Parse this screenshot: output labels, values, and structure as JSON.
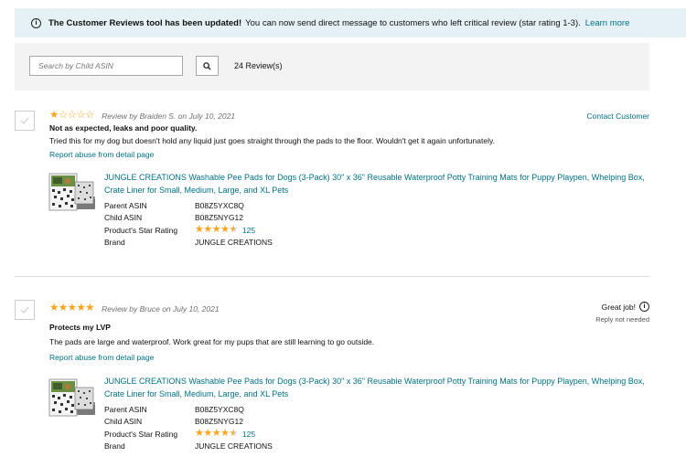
{
  "banner": {
    "bold_text": "The Customer Reviews tool has been updated!",
    "text": "You can now send direct message to customers who left critical review (star rating 1-3).",
    "link": "Learn more"
  },
  "search": {
    "placeholder": "Search by Child ASIN",
    "review_count": "24 Review(s)"
  },
  "icons": {
    "info": "info-icon",
    "search": "search-icon",
    "check": "checkmark-icon",
    "star": "star-icon"
  },
  "colors": {
    "link": "#007185",
    "star": "#ffa41c",
    "banner_bg": "#e5f1f4",
    "search_bg": "#f3f3f3"
  },
  "product_labels": {
    "parent_asin": "Parent ASIN",
    "child_asin": "Child ASIN",
    "star_rating": "Product's Star Rating",
    "brand": "Brand"
  },
  "reviews": [
    {
      "rating": 1,
      "byline": "Review by Braiden S. on July 10, 2021",
      "action": "Contact Customer",
      "title": "Not as expected, leaks and poor quality.",
      "body": "Tried this for my dog but doesn't hold any liquid just goes straight through the pads to the floor. Wouldn't get it again unfortunately.",
      "report": "Report abuse from detail page",
      "product": {
        "title": "JUNGLE CREATIONS Washable Pee Pads for Dogs (3-Pack) 30\" x 36\" Reusable Waterproof Potty Training Mats for Puppy Playpen, Whelping Box, Crate Liner for Small, Medium, Large, and XL Pets",
        "parent_asin": "B08Z5YXC8Q",
        "child_asin": "B08Z5NYG12",
        "star_rating": 4.5,
        "rating_count": "125",
        "brand": "JUNGLE CREATIONS"
      }
    },
    {
      "rating": 5,
      "byline": "Review by Bruce on July 10, 2021",
      "action": "Great job!",
      "reply_note": "Reply not needed",
      "title": "Protects my LVP",
      "body": "The pads are large and waterproof. Work great for my pups that are still learning to go outside.",
      "report": "Report abuse from detail page",
      "product": {
        "title": "JUNGLE CREATIONS Washable Pee Pads for Dogs (3-Pack) 30\" x 36\" Reusable Waterproof Potty Training Mats for Puppy Playpen, Whelping Box, Crate Liner for Small, Medium, Large, and XL Pets",
        "parent_asin": "B08Z5YXC8Q",
        "child_asin": "B08Z5NYG12",
        "star_rating": 4.5,
        "rating_count": "125",
        "brand": "JUNGLE CREATIONS"
      }
    }
  ]
}
